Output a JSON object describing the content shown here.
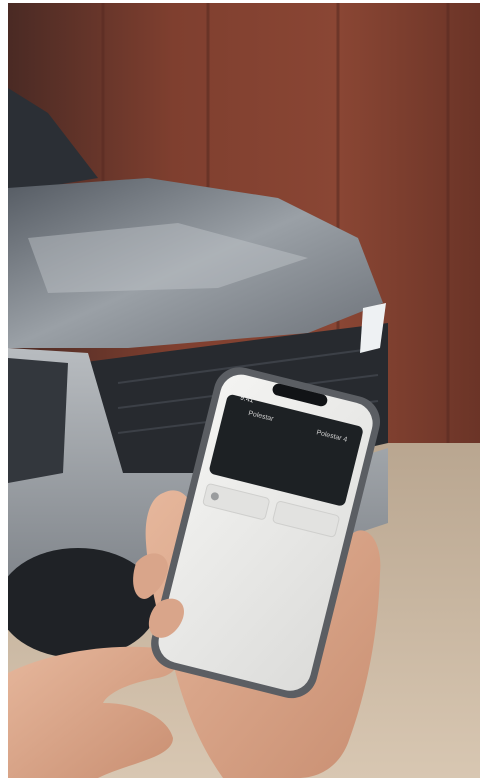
{
  "photo": {
    "subject": "hand holding smartphone in front of a car",
    "colors": {
      "wall": "#7a3d2e",
      "car_body": "#8d9298",
      "floor": "#c9b7a0",
      "phone_frame": "#5b5e63",
      "phone_card": "#1d2124",
      "phone_screen": "#eeeeec",
      "skin": "#d9a58a"
    }
  },
  "phone_screen": {
    "status_time": "9:41",
    "card_label": "Polestar",
    "card_right_label": "Polestar 4"
  }
}
